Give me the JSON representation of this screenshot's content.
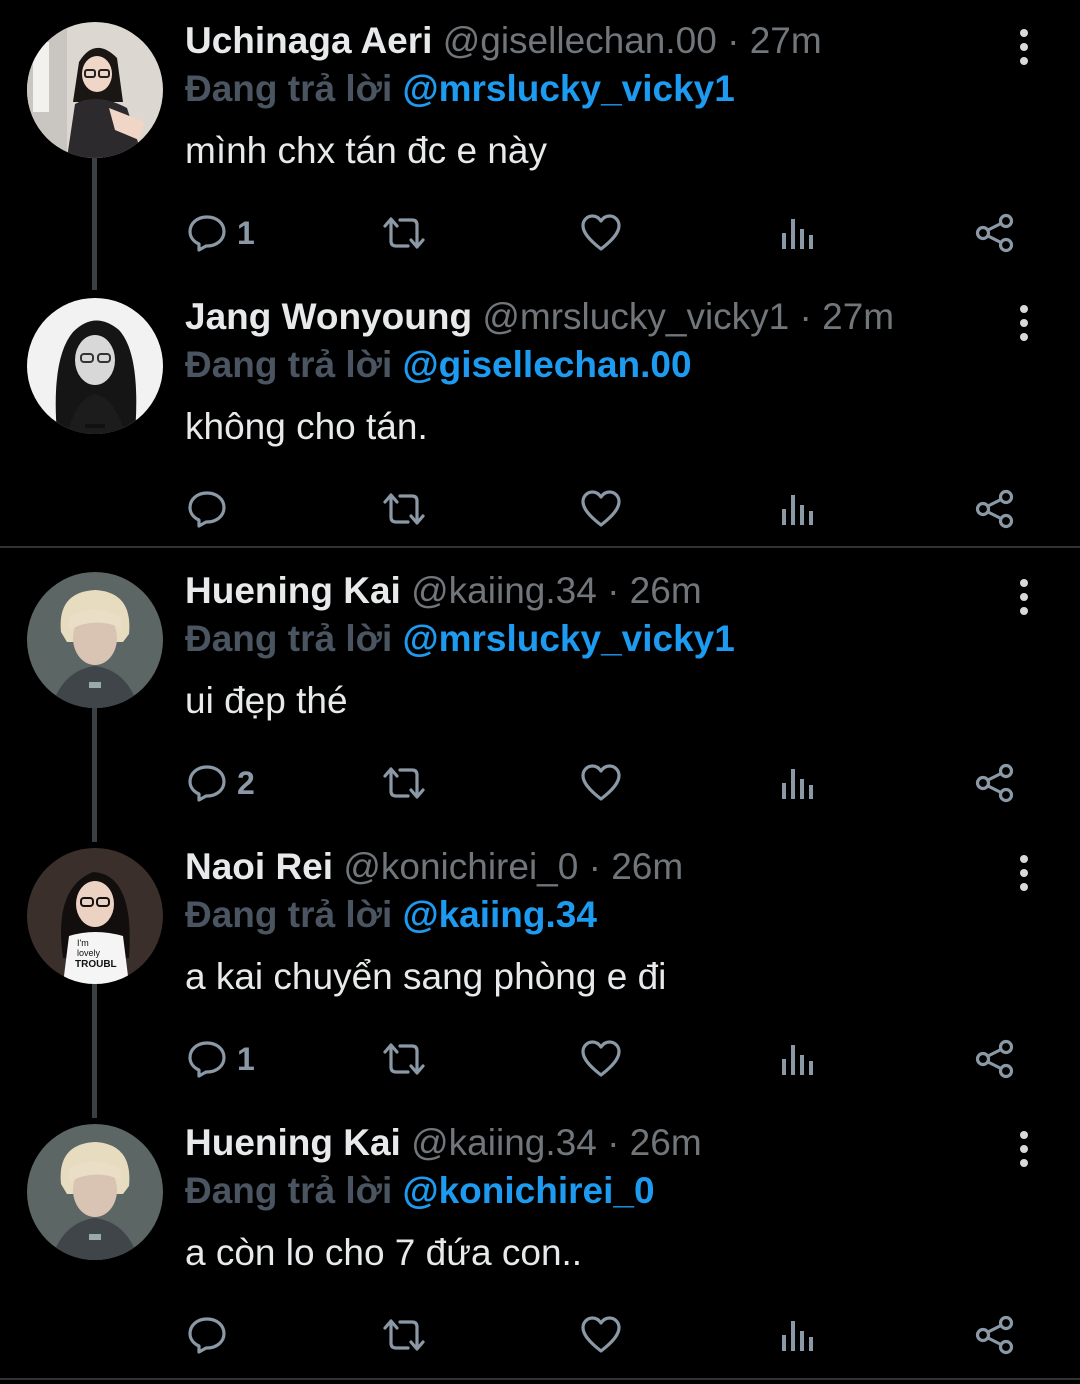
{
  "reply_prefix": "Đang trả lời",
  "colors": {
    "background": "#000000",
    "mention": "#1d9bf0",
    "muted": "#71767b",
    "reply_label": "#4a5561"
  },
  "tweets": [
    {
      "name": "Uchinaga Aeri",
      "handle": "@gisellechan.00",
      "time": "· 27m",
      "reply_to": "@mrslucky_vicky1",
      "text": "mình chx tán đc e này",
      "reply_count": "1",
      "avatar": "avatar-aeri"
    },
    {
      "name": "Jang Wonyoung",
      "handle": "@mrslucky_vicky1",
      "time": "· 27m",
      "reply_to": "@gisellechan.00",
      "text": "không cho tán.",
      "reply_count": "",
      "avatar": "avatar-wonyoung"
    },
    {
      "name": "Huening Kai",
      "handle": "@kaiing.34",
      "time": "· 26m",
      "reply_to": "@mrslucky_vicky1",
      "text": "ui đẹp thé",
      "reply_count": "2",
      "avatar": "avatar-kai"
    },
    {
      "name": "Naoi Rei",
      "handle": "@konichirei_0",
      "time": "· 26m",
      "reply_to": "@kaiing.34",
      "text": "a kai chuyển sang phòng e đi",
      "reply_count": "1",
      "avatar": "avatar-rei"
    },
    {
      "name": "Huening Kai",
      "handle": "@kaiing.34",
      "time": "· 26m",
      "reply_to": "@konichirei_0",
      "text": "a còn lo cho 7 đứa con..",
      "reply_count": "",
      "avatar": "avatar-kai"
    }
  ],
  "action_icons": [
    "reply-icon",
    "retweet-icon",
    "like-icon",
    "views-icon",
    "share-icon"
  ],
  "avatar_print": {
    "line1": "I'm",
    "line2": "lovely",
    "line3": "TROUBL"
  }
}
